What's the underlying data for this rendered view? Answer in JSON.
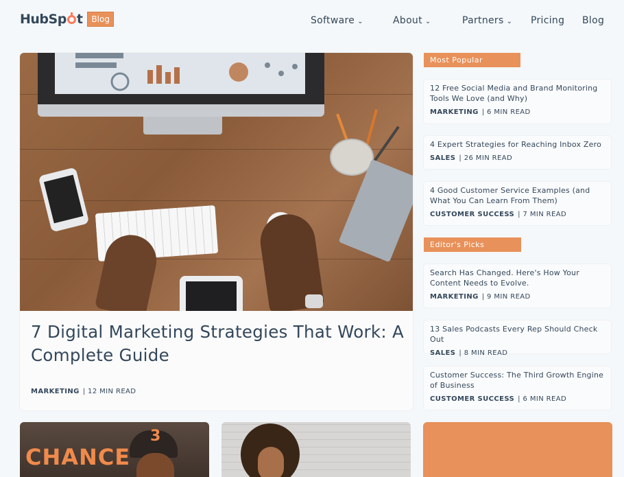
{
  "header": {
    "logo_text_left": "HubSp",
    "logo_text_right": "t",
    "blog_badge": "Blog",
    "nav": [
      {
        "label": "Software",
        "has_dropdown": true
      },
      {
        "label": "About",
        "has_dropdown": true
      },
      {
        "label": "Partners",
        "has_dropdown": true
      },
      {
        "label": "Pricing",
        "has_dropdown": false
      },
      {
        "label": "Blog",
        "has_dropdown": false
      }
    ],
    "caret": "⌄"
  },
  "featured": {
    "title": "7 Digital Marketing Strategies That Work: A Complete Guide",
    "tag": "MARKETING",
    "read_time": "| 12 MIN READ"
  },
  "sidebar": {
    "most_popular": {
      "header": "Most Popular",
      "items": [
        {
          "title": "12 Free Social Media and Brand Monitoring Tools We Love (and Why)",
          "tag": "MARKETING",
          "read_time": "| 6 MIN READ"
        },
        {
          "title": "4 Expert Strategies for Reaching Inbox Zero",
          "tag": "SALES",
          "read_time": "| 26 MIN READ"
        },
        {
          "title": "4 Good Customer Service Examples (and What You Can Learn From Them)",
          "tag": "CUSTOMER SUCCESS",
          "read_time": "| 7 MIN READ"
        }
      ]
    },
    "editors_picks": {
      "header": "Editor's Picks",
      "items": [
        {
          "title": "Search Has Changed. Here's How Your Content Needs to Evolve.",
          "tag": "MARKETING",
          "read_time": "| 9 MIN READ"
        },
        {
          "title": "13 Sales Podcasts Every Rep Should Check Out",
          "tag": "SALES",
          "read_time": "| 8 MIN READ"
        },
        {
          "title": "Customer Success: The Third Growth Engine of Business",
          "tag": "CUSTOMER SUCCESS",
          "read_time": "| 6 MIN READ"
        }
      ]
    }
  },
  "bottom_cards": {
    "chance_text": "CHANCE",
    "chance_number": "3"
  },
  "colors": {
    "accent": "#e8915a",
    "text": "#33475b",
    "background": "#f5f8fa"
  }
}
